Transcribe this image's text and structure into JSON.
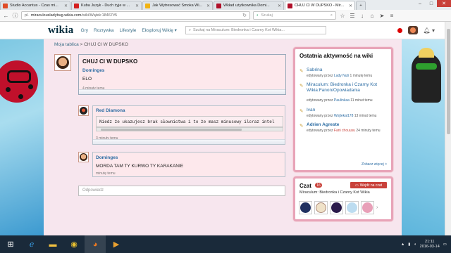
{
  "browser": {
    "tabs": [
      {
        "title": "Studio Accantus - Czas mi...",
        "color": "#e04b26",
        "active": false
      },
      {
        "title": "Kuba Juzyk - Duch żyje w ...",
        "color": "#d42020",
        "active": false
      },
      {
        "title": "Jak Wytresować Smoka Wi...",
        "color": "#f2b312",
        "active": false
      },
      {
        "title": "Wkład użytkownika Domi...",
        "color": "#b0102a",
        "active": false
      },
      {
        "title": "CHUJ CI W DUPSKO - Mir...",
        "color": "#b0102a",
        "active": true
      }
    ],
    "url_domain_prefix": "pl.",
    "url_domain_main": "miraculousladybug.wikia.com",
    "url_path": "/wiki/Wątek:18467#5",
    "search_placeholder": "Szukaj",
    "close_glyph": "✕",
    "win_min": "–",
    "win_max": "□",
    "win_close": "✕"
  },
  "wiki": {
    "logo": "wikia",
    "nav": [
      "Gry",
      "Rozrywka",
      "Lifestyle",
      "Eksploruj Wikię ▾"
    ],
    "search_placeholder": "Szukaj na Miraculum: Biedronka i Czarny Kot Wikia..."
  },
  "breadcrumb": {
    "link": "Moja tablica",
    "sep": ">",
    "current": "CHUJ CI W DUPSKO"
  },
  "thread": {
    "title": "CHUJ CI W DUPSKO",
    "posts": [
      {
        "author": "Dominges",
        "text": "ELO",
        "time": "4 minuty temu"
      },
      {
        "author": "Red Diamona",
        "text": "Niedz że ukazujesz brak słownictwa i to że masz minusowy ilcraz intel",
        "time": "3 minuty temu"
      },
      {
        "author": "Dominges",
        "text": "MORDA TAM TY KURWO TY KARAKANIE",
        "time": "minutę temu"
      }
    ],
    "reply_placeholder": "Odpowiedz"
  },
  "activity": {
    "title": "Ostatnia aktywność na wiki",
    "items": [
      {
        "link": "Sabrina",
        "meta_prefix": "edytowany przez",
        "user": "Lady Nuti",
        "when": "1 minutę temu",
        "bold": false,
        "user_red": false
      },
      {
        "link": "Miraculum: Biedronka i Czarny Kot Wikia:Fanon/Opowiadania",
        "meta_prefix": "edytowany przez",
        "user": "Paulinkaa",
        "when": "11 minut temu",
        "bold": false,
        "user_red": false
      },
      {
        "link": "Ivan",
        "meta_prefix": "edytowany przez",
        "user": "Wojtekal178",
        "when": "13 minut temu",
        "bold": false,
        "user_red": false
      },
      {
        "link": "Adrien Agreste",
        "meta_prefix": "edytowany przez",
        "user": "Fani chouusu",
        "when": "24 minuty temu",
        "bold": true,
        "user_red": true
      }
    ],
    "see_more": "Zobacz więcej >"
  },
  "chat": {
    "title": "Czat",
    "count": "16",
    "join": "Wejdź na czat",
    "subtitle": "Miraculum: Biedronka i Czarny Kot Wikia",
    "next": "›",
    "avatars": [
      "#203060",
      "#f0e2c8",
      "#2a1a4a",
      "#bcdcf0",
      "#e8a0b8"
    ]
  },
  "taskbar": {
    "time": "21:11",
    "date": "2016-03-14"
  }
}
